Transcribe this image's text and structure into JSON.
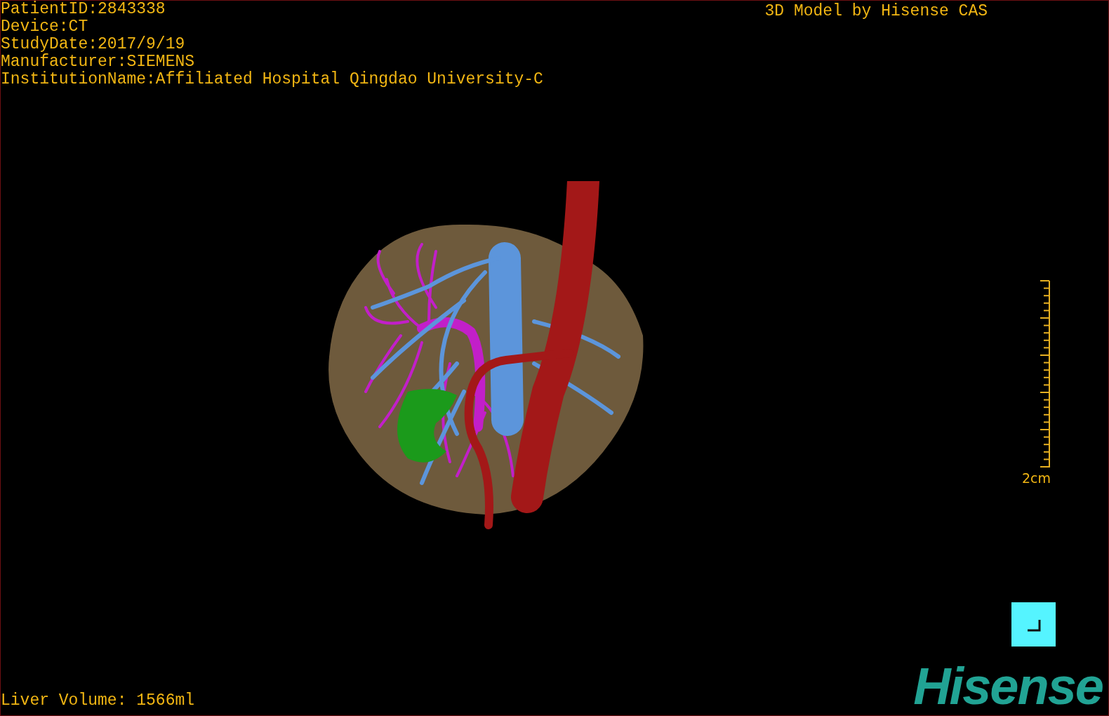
{
  "overlay_info": [
    "PatientID:2843338",
    "Device:CT",
    "StudyDate:2017/9/19",
    "Manufacturer:SIEMENS",
    "InstitutionName:Affiliated Hospital Qingdao University-C"
  ],
  "title": "3D Model by Hisense CAS",
  "scale_bar": {
    "label": "2cm"
  },
  "liver_volume": "Liver Volume: 1566ml",
  "logo": "Hisense"
}
